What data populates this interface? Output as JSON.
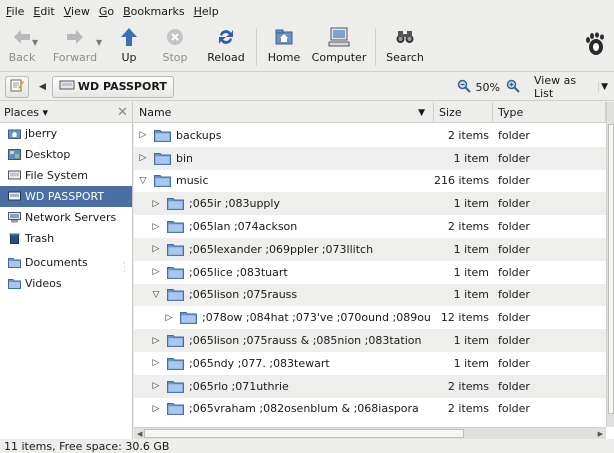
{
  "menubar": {
    "items": [
      {
        "u": "F",
        "rest": "ile"
      },
      {
        "u": "E",
        "rest": "dit"
      },
      {
        "u": "V",
        "rest": "iew"
      },
      {
        "u": "G",
        "rest": "o"
      },
      {
        "u": "B",
        "rest": "ookmarks"
      },
      {
        "u": "H",
        "rest": "elp"
      }
    ]
  },
  "toolbar": {
    "back": "Back",
    "forward": "Forward",
    "up": "Up",
    "stop": "Stop",
    "reload": "Reload",
    "home": "Home",
    "computer": "Computer",
    "search": "Search"
  },
  "location": {
    "current": "WD PASSPORT",
    "zoom": "50%",
    "view_mode": "View as List"
  },
  "sidebar": {
    "header": "Places",
    "items": [
      {
        "label": "jberry",
        "icon": "home-folder-icon"
      },
      {
        "label": "Desktop",
        "icon": "desktop-icon"
      },
      {
        "label": "File System",
        "icon": "filesystem-icon"
      },
      {
        "label": "WD PASSPORT",
        "icon": "drive-icon"
      },
      {
        "label": "Network Servers",
        "icon": "network-icon"
      },
      {
        "label": "Trash",
        "icon": "trash-icon"
      },
      {
        "label": "Documents",
        "icon": "folder-icon"
      },
      {
        "label": "Videos",
        "icon": "folder-icon"
      }
    ]
  },
  "columns": {
    "name": "Name",
    "size": "Size",
    "type": "Type"
  },
  "rows": [
    {
      "name": "backups",
      "size": "2 items",
      "type": "folder",
      "level": 0,
      "expanded": false
    },
    {
      "name": "bin",
      "size": "1 item",
      "type": "folder",
      "level": 0,
      "expanded": false
    },
    {
      "name": "music",
      "size": "216 items",
      "type": "folder",
      "level": 0,
      "expanded": true
    },
    {
      "name": ";065ir ;083upply",
      "size": "1 item",
      "type": "folder",
      "level": 1,
      "expanded": false
    },
    {
      "name": ";065lan ;074ackson",
      "size": "2 items",
      "type": "folder",
      "level": 1,
      "expanded": false
    },
    {
      "name": ";065lexander ;069ppler ;073llitch",
      "size": "1 item",
      "type": "folder",
      "level": 1,
      "expanded": false
    },
    {
      "name": ";065lice ;083tuart",
      "size": "1 item",
      "type": "folder",
      "level": 1,
      "expanded": false
    },
    {
      "name": ";065lison ;075rauss",
      "size": "1 item",
      "type": "folder",
      "level": 1,
      "expanded": true
    },
    {
      "name": ";078ow ;084hat ;073've ;070ound ;089ou",
      "size": "12 items",
      "type": "folder",
      "level": 2,
      "expanded": false
    },
    {
      "name": ";065lison ;075rauss & ;085nion ;083tation",
      "size": "1 item",
      "type": "folder",
      "level": 1,
      "expanded": false
    },
    {
      "name": ";065ndy ;077. ;083tewart",
      "size": "1 item",
      "type": "folder",
      "level": 1,
      "expanded": false
    },
    {
      "name": ";065rlo ;071uthrie",
      "size": "2 items",
      "type": "folder",
      "level": 1,
      "expanded": false
    },
    {
      "name": ";065vraham ;082osenblum & ;068iaspora",
      "size": "2 items",
      "type": "folder",
      "level": 1,
      "expanded": false
    }
  ],
  "status": "11 items, Free space: 30.6 GB"
}
